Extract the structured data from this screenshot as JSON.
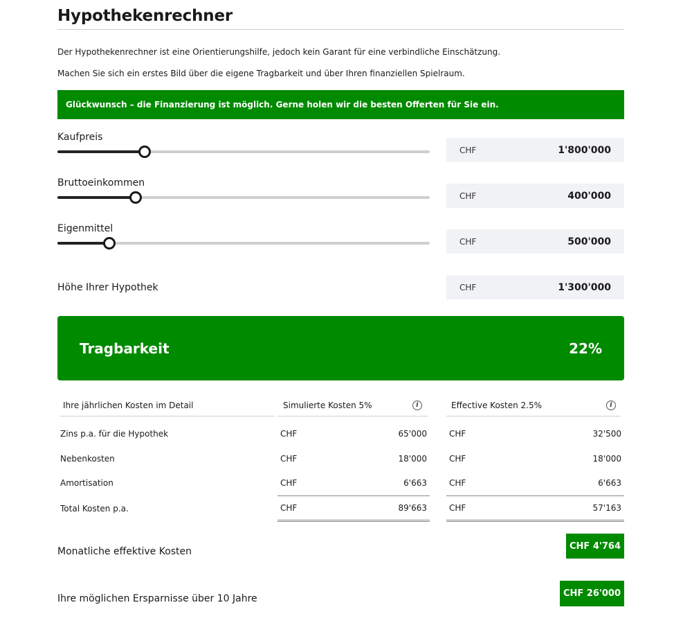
{
  "page": {
    "title": "Hypothekenrechner",
    "intro_1": "Der Hypothekenrechner ist eine Orientierungshilfe, jedoch kein Garant für eine verbindliche Einschätzung.",
    "intro_2": "Machen Sie sich ein erstes Bild über die eigene Tragbarkeit und über Ihren finanziellen Spielraum.",
    "banner": "Glückwunsch – die Finanzierung ist möglich. Gerne holen wir die besten Offerten für Sie ein."
  },
  "sliders": [
    {
      "label": "Kaufpreis",
      "currency": "CHF",
      "value": "1'800'000",
      "position": 0.233
    },
    {
      "label": "Bruttoeinkommen",
      "currency": "CHF",
      "value": "400'000",
      "position": 0.209
    },
    {
      "label": "Eigenmittel",
      "currency": "CHF",
      "value": "500'000",
      "position": 0.137
    }
  ],
  "mortgage": {
    "label": "Höhe Ihrer Hypothek",
    "currency": "CHF",
    "value": "1'300'000"
  },
  "affordability": {
    "label": "Tragbarkeit",
    "value": "22%"
  },
  "costs": {
    "header_label": "Ihre jährlichen Kosten im Detail",
    "header_simulated": "Simulierte Kosten 5%",
    "header_effective": "Effective Kosten 2.5%",
    "info_icon": "info-icon",
    "rows": [
      {
        "label": "Zins p.a. für die Hypothek",
        "sim_cur": "CHF",
        "sim_val": "65'000",
        "eff_cur": "CHF",
        "eff_val": "32'500"
      },
      {
        "label": "Nebenkosten",
        "sim_cur": "CHF",
        "sim_val": "18'000",
        "eff_cur": "CHF",
        "eff_val": "18'000"
      },
      {
        "label": "Amortisation",
        "sim_cur": "CHF",
        "sim_val": "6'663",
        "eff_cur": "CHF",
        "eff_val": "6'663"
      },
      {
        "label": "Total Kosten p.a.",
        "sim_cur": "CHF",
        "sim_val": "89'663",
        "eff_cur": "CHF",
        "eff_val": "57'163"
      }
    ]
  },
  "summary": {
    "monthly_label": "Monatliche effektive Kosten",
    "monthly_value": "CHF 4'764",
    "savings_label": "Ihre möglichen Ersparnisse über 10 Jahre",
    "savings_value": "CHF 26'000"
  },
  "colors": {
    "accent_green": "#008a00",
    "value_box_bg": "#f1f2f5"
  }
}
